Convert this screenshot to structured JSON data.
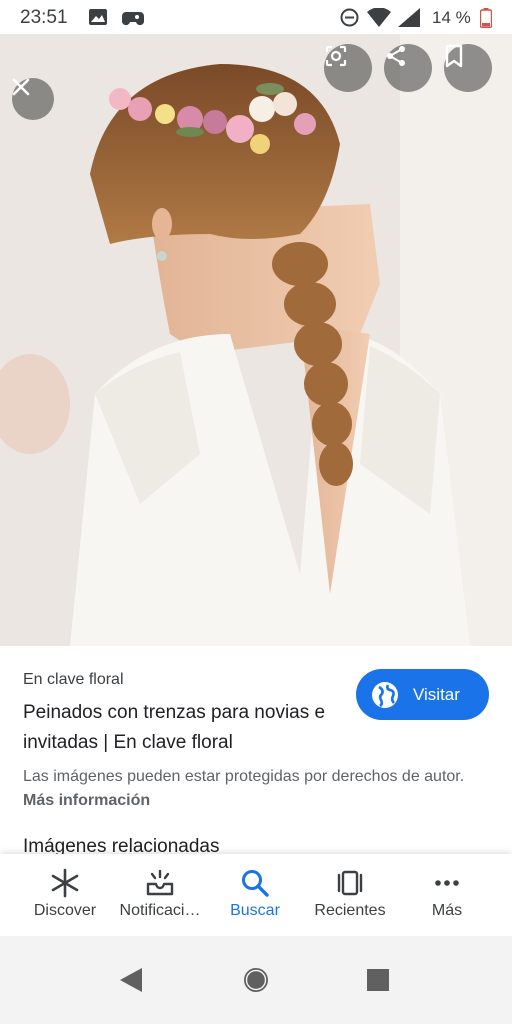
{
  "status_bar": {
    "time": "23:51",
    "battery": "14 %"
  },
  "result": {
    "source": "En clave floral",
    "title": "Peinados con trenzas para novias e invitadas | En clave floral",
    "visit_label": "Visitar",
    "notice_text": "Las imágenes pueden estar protegidas por derechos de autor.",
    "notice_link": "Más información",
    "related_heading": "Imágenes relacionadas"
  },
  "bottom_nav": {
    "items": [
      {
        "label": "Discover",
        "icon": "asterisk-icon"
      },
      {
        "label": "Notificaci…",
        "icon": "inbox-bell-icon"
      },
      {
        "label": "Buscar",
        "icon": "search-icon",
        "active": true
      },
      {
        "label": "Recientes",
        "icon": "recent-tabs-icon"
      },
      {
        "label": "Más",
        "icon": "more-dots-icon"
      }
    ]
  },
  "colors": {
    "accent": "#1a73e8",
    "overlay_button": "#5a5a5a"
  }
}
